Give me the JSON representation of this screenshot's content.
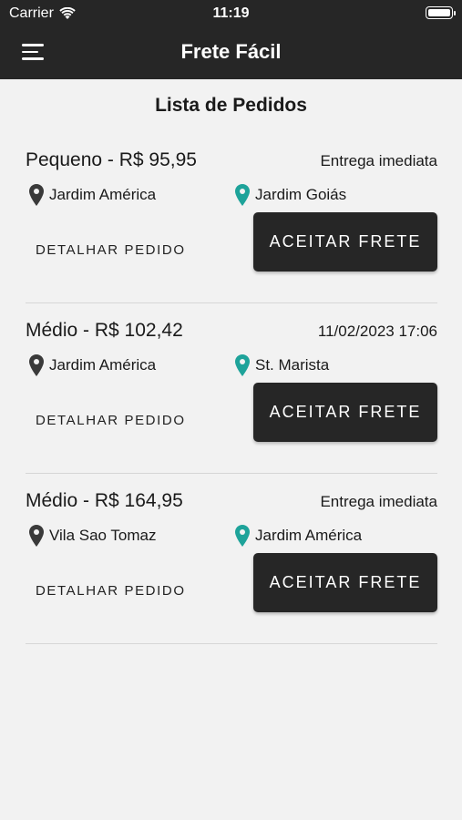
{
  "status_bar": {
    "carrier": "Carrier",
    "time": "11:19"
  },
  "header": {
    "title": "Frete Fácil"
  },
  "page": {
    "title": "Lista de Pedidos"
  },
  "colors": {
    "dark": "#262626",
    "teal_pin": "#1ea39a",
    "dark_pin": "#3a3a3a"
  },
  "orders": [
    {
      "title": "Pequeno - R$ 95,95",
      "tag": "Entrega imediata",
      "origin": "Jardim América",
      "destination": "Jardim Goiás",
      "detail_label": "DETALHAR PEDIDO",
      "accept_label": "ACEITAR FRETE"
    },
    {
      "title": "Médio - R$ 102,42",
      "tag": "11/02/2023 17:06",
      "origin": "Jardim América",
      "destination": "St. Marista",
      "detail_label": "DETALHAR PEDIDO",
      "accept_label": "ACEITAR FRETE"
    },
    {
      "title": "Médio - R$ 164,95",
      "tag": "Entrega imediata",
      "origin": "Vila Sao Tomaz",
      "destination": "Jardim América",
      "detail_label": "DETALHAR PEDIDO",
      "accept_label": "ACEITAR FRETE"
    }
  ]
}
